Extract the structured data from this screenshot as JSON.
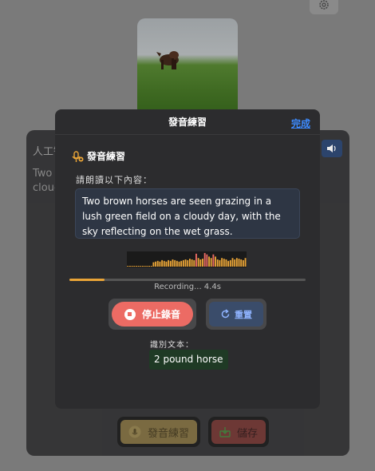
{
  "background": {
    "settings_icon": "gear-icon",
    "card": {
      "title": "人工智",
      "text_line1": "Two",
      "text_line2": "clouc",
      "speaker_icon": "speaker-icon"
    },
    "buttons": {
      "practice_label": "發音練習",
      "save_label": "儲存"
    }
  },
  "modal": {
    "title": "發音練習",
    "done_label": "完成",
    "section_title": "發音練習",
    "section_icon": "mic-plus-icon",
    "instruction": "請朗讀以下內容：",
    "passage": " Two brown horses are seen grazing in a lush green field on a cloudy day, with the sky reflecting on the wet grass.",
    "waveform": {
      "levels": [
        0.05,
        0.05,
        0.05,
        0.05,
        0.05,
        0.05,
        0.05,
        0.05,
        0.05,
        0.05,
        0.05,
        0.05,
        0.3,
        0.35,
        0.4,
        0.35,
        0.45,
        0.4,
        0.35,
        0.45,
        0.4,
        0.5,
        0.45,
        0.4,
        0.35,
        0.4,
        0.45,
        0.5,
        0.45,
        0.55,
        0.5,
        0.45,
        0.9,
        0.6,
        0.5,
        0.55,
        0.95,
        0.85,
        0.7,
        0.6,
        0.85,
        0.7,
        0.5,
        0.45,
        0.6,
        0.55,
        0.5,
        0.4,
        0.45,
        0.6,
        0.5,
        0.6,
        0.55,
        0.5,
        0.45,
        0.6
      ],
      "color_low": "#e9a437",
      "color_high": "#ec6b64"
    },
    "progress": 0.15,
    "status": "Recording... 4.4s",
    "stop_label": "停止錄音",
    "reset_label": "重置",
    "recognized_label": "識別文本：",
    "recognized_text": "2 pound horse"
  }
}
